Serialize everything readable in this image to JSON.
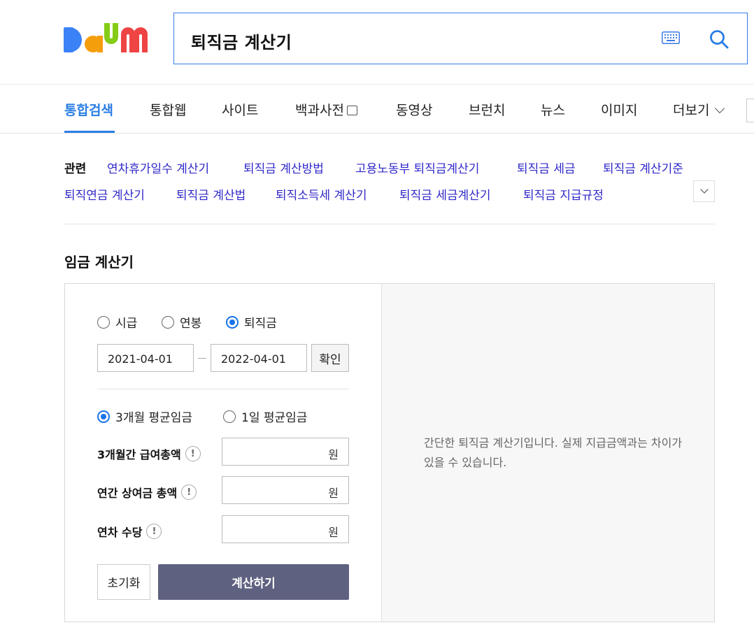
{
  "header": {
    "logo_text": "Daum",
    "search_query": "퇴직금 계산기"
  },
  "nav": {
    "tabs": [
      {
        "label": "통합검색",
        "active": true
      },
      {
        "label": "통합웹"
      },
      {
        "label": "사이트"
      },
      {
        "label": "백과사전"
      },
      {
        "label": "동영상"
      },
      {
        "label": "브런치"
      },
      {
        "label": "뉴스"
      },
      {
        "label": "이미지"
      },
      {
        "label": "더보기"
      }
    ]
  },
  "related": {
    "title": "관련",
    "links": [
      "연차휴가일수 계산기",
      "퇴직금 계산방법",
      "고용노동부 퇴직금계산기",
      "퇴직금 세금",
      "퇴직금 계산기준",
      "퇴직연금 계산기",
      "퇴직금 계산법",
      "퇴직소득세 계산기",
      "퇴직금 세금계산기",
      "퇴직금 지급규정"
    ]
  },
  "calculator": {
    "title": "임금 계산기",
    "type_options": [
      "시급",
      "연봉",
      "퇴직금"
    ],
    "selected_type": "퇴직금",
    "start_date": "2021-04-01",
    "end_date": "2022-04-01",
    "confirm_label": "확인",
    "avg_options": [
      "3개월 평균임금",
      "1일 평균임금"
    ],
    "selected_avg": "3개월 평균임금",
    "fields": [
      {
        "label": "3개월간 급여총액",
        "unit": "원",
        "value": ""
      },
      {
        "label": "연간 상여금 총액",
        "unit": "원",
        "value": ""
      },
      {
        "label": "연차 수당",
        "unit": "원",
        "value": ""
      }
    ],
    "reset_label": "초기화",
    "calculate_label": "계산하기",
    "description": "간단한 퇴직금 계산기입니다. 실제 지급금액과는 차이가 있을 수 있습니다."
  },
  "colors": {
    "accent": "#2a7ee5",
    "link": "#3129c9",
    "button": "#5e6180"
  }
}
